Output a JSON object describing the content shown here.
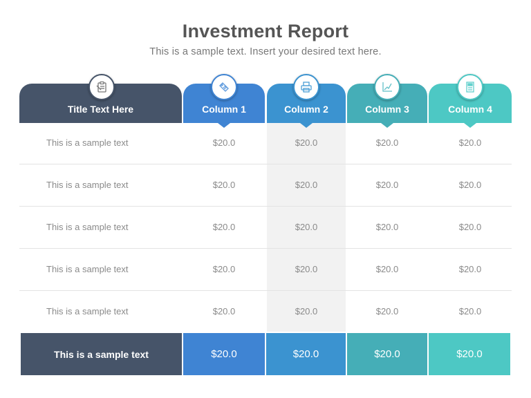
{
  "title": "Investment Report",
  "subtitle": "This is a sample text. Insert your desired text here.",
  "colors": {
    "title_col": "#465469",
    "col1": "#3f84d3",
    "col2": "#3b93d0",
    "col3": "#45aeb7",
    "col4": "#4dc8c4",
    "highlight_bg": "#f2f2f2"
  },
  "header": {
    "title_col": {
      "label": "Title Text Here",
      "icon": "clipboard-icon"
    },
    "columns": [
      {
        "label": "Column 1",
        "icon": "tag-icon"
      },
      {
        "label": "Column 2",
        "icon": "printer-icon"
      },
      {
        "label": "Column 3",
        "icon": "line-chart-icon"
      },
      {
        "label": "Column 4",
        "icon": "document-icon"
      }
    ]
  },
  "rows": [
    {
      "label": "This is a sample text",
      "values": [
        "$20.0",
        "$20.0",
        "$20.0",
        "$20.0"
      ]
    },
    {
      "label": "This is a sample text",
      "values": [
        "$20.0",
        "$20.0",
        "$20.0",
        "$20.0"
      ]
    },
    {
      "label": "This is a sample text",
      "values": [
        "$20.0",
        "$20.0",
        "$20.0",
        "$20.0"
      ]
    },
    {
      "label": "This is a sample text",
      "values": [
        "$20.0",
        "$20.0",
        "$20.0",
        "$20.0"
      ]
    },
    {
      "label": "This is a sample text",
      "values": [
        "$20.0",
        "$20.0",
        "$20.0",
        "$20.0"
      ]
    }
  ],
  "footer": {
    "label": "This is a sample text",
    "values": [
      "$20.0",
      "$20.0",
      "$20.0",
      "$20.0"
    ]
  }
}
